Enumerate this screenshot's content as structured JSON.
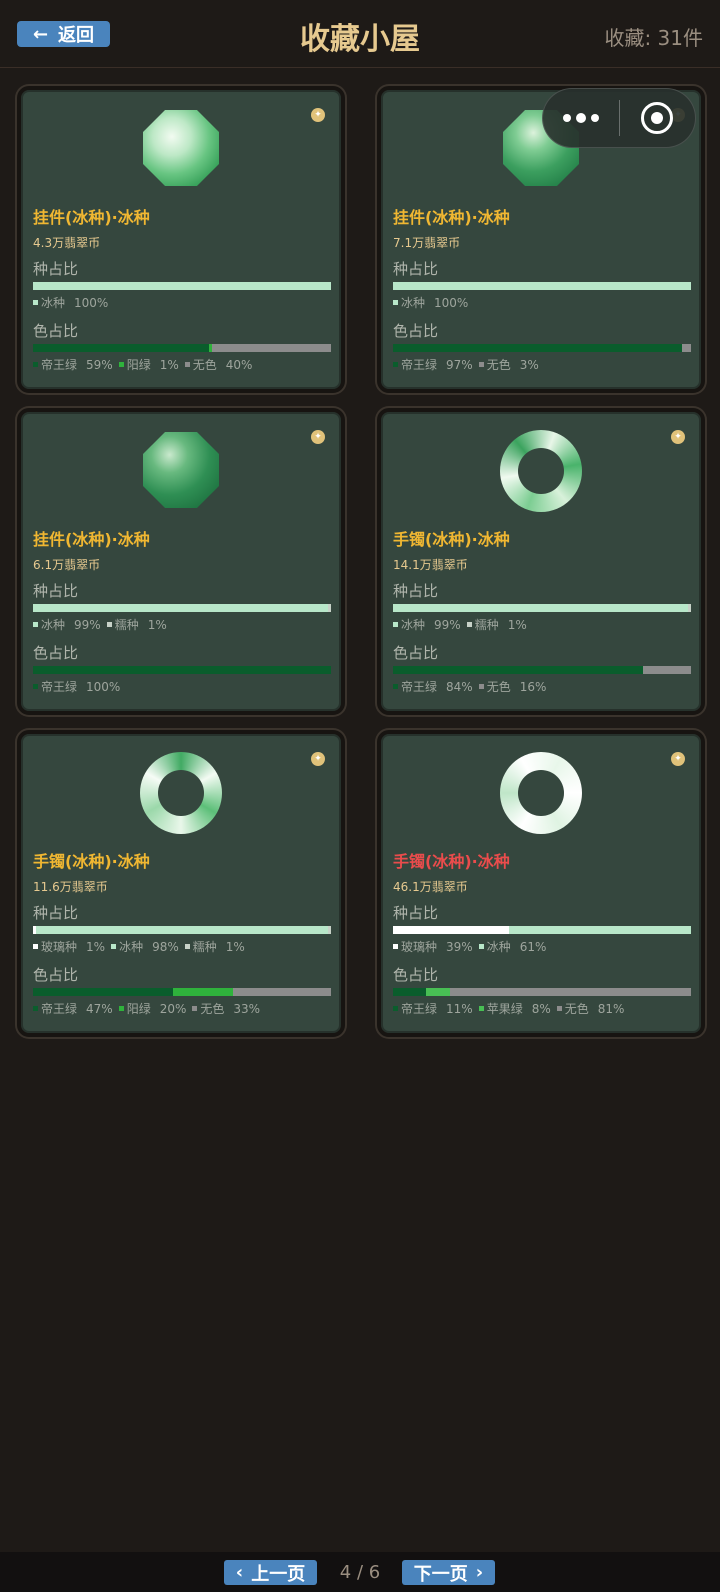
{
  "header": {
    "back_label": "返回",
    "back_arrow": "←",
    "title": "收藏小屋",
    "count": "收藏: 31件"
  },
  "colors": {
    "icy": "#b8e7c9",
    "glass": "#ffffff",
    "glutinous": "#c8d2c8",
    "imperial": "#0a5d2c",
    "yang": "#2fb23c",
    "apple": "#48bf54",
    "none": "#8c8c8c"
  },
  "cards": [
    {
      "name": "挂件(冰种)·冰种",
      "price": "4.3万翡翠币",
      "zhong_title": "种占比",
      "se_title": "色占比",
      "zhong": [
        {
          "label": "冰种",
          "pct": "100%",
          "color": "#b8e7c9",
          "value": 100
        }
      ],
      "se": [
        {
          "label": "帝王绿",
          "pct": "59%",
          "color": "#0a5d2c",
          "value": 59
        },
        {
          "label": "阳绿",
          "pct": "1%",
          "color": "#2fb23c",
          "value": 1
        },
        {
          "label": "无色",
          "pct": "40%",
          "color": "#8c8c8c",
          "value": 40
        }
      ]
    },
    {
      "name": "挂件(冰种)·冰种",
      "price": "7.1万翡翠币",
      "zhong_title": "种占比",
      "se_title": "色占比",
      "zhong": [
        {
          "label": "冰种",
          "pct": "100%",
          "color": "#b8e7c9",
          "value": 100
        }
      ],
      "se": [
        {
          "label": "帝王绿",
          "pct": "97%",
          "color": "#0a5d2c",
          "value": 97
        },
        {
          "label": "无色",
          "pct": "3%",
          "color": "#8c8c8c",
          "value": 3
        }
      ]
    },
    {
      "name": "挂件(冰种)·冰种",
      "price": "6.1万翡翠币",
      "zhong_title": "种占比",
      "se_title": "色占比",
      "zhong": [
        {
          "label": "冰种",
          "pct": "99%",
          "color": "#b8e7c9",
          "value": 99
        },
        {
          "label": "糯种",
          "pct": "1%",
          "color": "#c8d2c8",
          "value": 1
        }
      ],
      "se": [
        {
          "label": "帝王绿",
          "pct": "100%",
          "color": "#0a5d2c",
          "value": 100
        }
      ]
    },
    {
      "name": "手镯(冰种)·冰种",
      "price": "14.1万翡翠币",
      "zhong_title": "种占比",
      "se_title": "色占比",
      "zhong": [
        {
          "label": "冰种",
          "pct": "99%",
          "color": "#b8e7c9",
          "value": 99
        },
        {
          "label": "糯种",
          "pct": "1%",
          "color": "#c8d2c8",
          "value": 1
        }
      ],
      "se": [
        {
          "label": "帝王绿",
          "pct": "84%",
          "color": "#0a5d2c",
          "value": 84
        },
        {
          "label": "无色",
          "pct": "16%",
          "color": "#8c8c8c",
          "value": 16
        }
      ]
    },
    {
      "name": "手镯(冰种)·冰种",
      "price": "11.6万翡翠币",
      "zhong_title": "种占比",
      "se_title": "色占比",
      "zhong": [
        {
          "label": "玻璃种",
          "pct": "1%",
          "color": "#ffffff",
          "value": 1
        },
        {
          "label": "冰种",
          "pct": "98%",
          "color": "#b8e7c9",
          "value": 98
        },
        {
          "label": "糯种",
          "pct": "1%",
          "color": "#c8d2c8",
          "value": 1
        }
      ],
      "se": [
        {
          "label": "帝王绿",
          "pct": "47%",
          "color": "#0a5d2c",
          "value": 47
        },
        {
          "label": "阳绿",
          "pct": "20%",
          "color": "#2fb23c",
          "value": 20
        },
        {
          "label": "无色",
          "pct": "33%",
          "color": "#8c8c8c",
          "value": 33
        }
      ]
    },
    {
      "name": "手镯(冰种)·冰种",
      "price": "46.1万翡翠币",
      "zhong_title": "种占比",
      "se_title": "色占比",
      "zhong": [
        {
          "label": "玻璃种",
          "pct": "39%",
          "color": "#ffffff",
          "value": 39
        },
        {
          "label": "冰种",
          "pct": "61%",
          "color": "#b8e7c9",
          "value": 61
        }
      ],
      "se": [
        {
          "label": "帝王绿",
          "pct": "11%",
          "color": "#0a5d2c",
          "value": 11
        },
        {
          "label": "苹果绿",
          "pct": "8%",
          "color": "#48bf54",
          "value": 8
        },
        {
          "label": "无色",
          "pct": "81%",
          "color": "#8c8c8c",
          "value": 81
        }
      ]
    }
  ],
  "pagination": {
    "prev_label": "上一页",
    "next_label": "下一页",
    "prev_icon": "‹",
    "next_icon": "›",
    "page_text": "4 / 6"
  }
}
